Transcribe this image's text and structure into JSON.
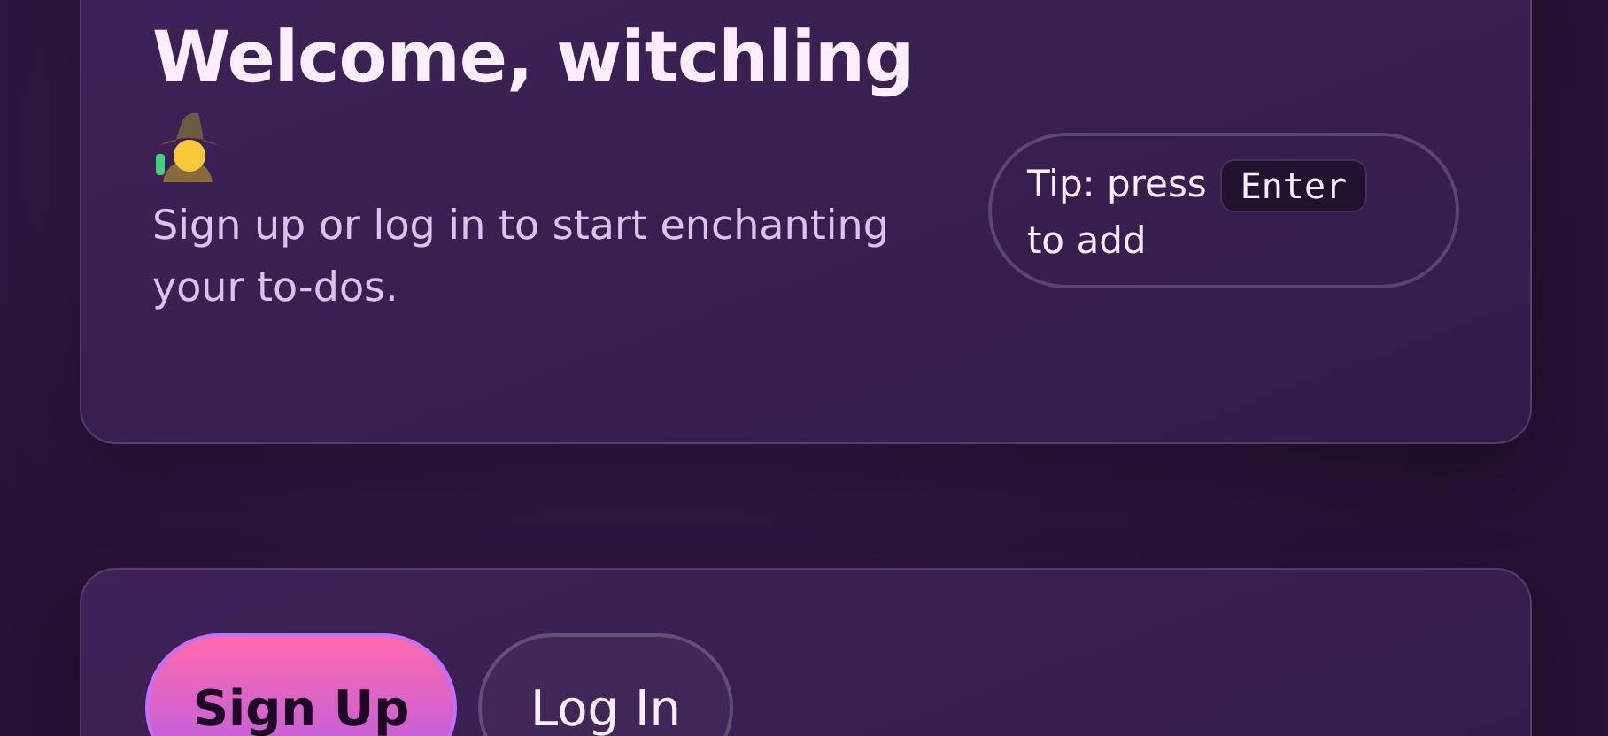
{
  "welcome": {
    "title": "Welcome, witchling",
    "subtitle": "Sign up or log in to start enchanting your to-dos.",
    "tip": {
      "before": "Tip: press",
      "key": "Enter",
      "after": "to add"
    }
  },
  "auth": {
    "buttons": [
      {
        "label": "Sign Up",
        "kind": "primary"
      },
      {
        "label": "Log In",
        "kind": "secondary"
      }
    ]
  }
}
